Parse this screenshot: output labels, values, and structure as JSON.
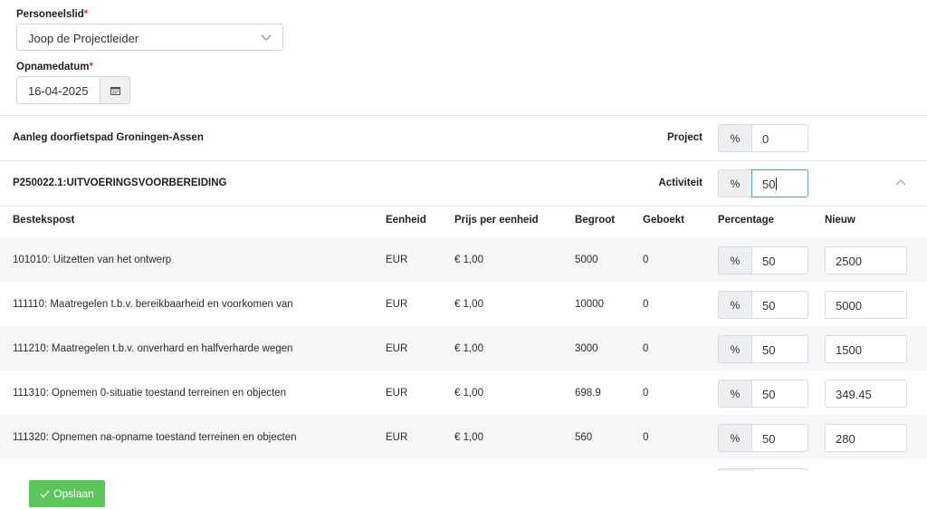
{
  "form": {
    "personeelslid_label": "Personeelslid",
    "required_mark": "*",
    "personeelslid_value": "Joop de Projectleider",
    "opnamedatum_label": "Opnamedatum",
    "opnamedatum_value": "16-04-2025"
  },
  "project": {
    "title": "Aanleg doorfietspad Groningen-Assen",
    "label": "Project",
    "percent_symbol": "%",
    "value": "0"
  },
  "activity": {
    "title": "P250022.1:UITVOERINGSVOORBEREIDING",
    "label": "Activiteit",
    "percent_symbol": "%",
    "value": "50"
  },
  "table": {
    "headers": [
      "Bestekspost",
      "Eenheid",
      "Prijs per eenheid",
      "Begroot",
      "Geboekt",
      "Percentage",
      "Nieuw"
    ],
    "rows": [
      {
        "post": "101010: Uitzetten van het ontwerp",
        "eenheid": "EUR",
        "prijs": "€ 1,00",
        "begroot": "5000",
        "geboekt": "0",
        "pct_symbol": "%",
        "percentage": "50",
        "nieuw": "2500"
      },
      {
        "post": "111110: Maatregelen t.b.v. bereikbaarheid en voorkomen van",
        "eenheid": "EUR",
        "prijs": "€ 1,00",
        "begroot": "10000",
        "geboekt": "0",
        "pct_symbol": "%",
        "percentage": "50",
        "nieuw": "5000"
      },
      {
        "post": "111210: Maatregelen t.b.v. onverhard en halfverharde wegen",
        "eenheid": "EUR",
        "prijs": "€ 1,00",
        "begroot": "3000",
        "geboekt": "0",
        "pct_symbol": "%",
        "percentage": "50",
        "nieuw": "1500"
      },
      {
        "post": "111310: Opnemen 0-situatie toestand terreinen en objecten",
        "eenheid": "EUR",
        "prijs": "€ 1,00",
        "begroot": "698.9",
        "geboekt": "0",
        "pct_symbol": "%",
        "percentage": "50",
        "nieuw": "349.45"
      },
      {
        "post": "111320: Opnemen na-opname toestand terreinen en objecten",
        "eenheid": "EUR",
        "prijs": "€ 1,00",
        "begroot": "560",
        "geboekt": "0",
        "pct_symbol": "%",
        "percentage": "50",
        "nieuw": "280"
      }
    ]
  },
  "footer": {
    "save_label": "Opslaan",
    "save_color": "#5cc55c"
  },
  "icons": {
    "select": "chevron-down-icon",
    "date": "calendar-icon",
    "collapse": "chevron-up-icon",
    "save": "check-icon"
  }
}
